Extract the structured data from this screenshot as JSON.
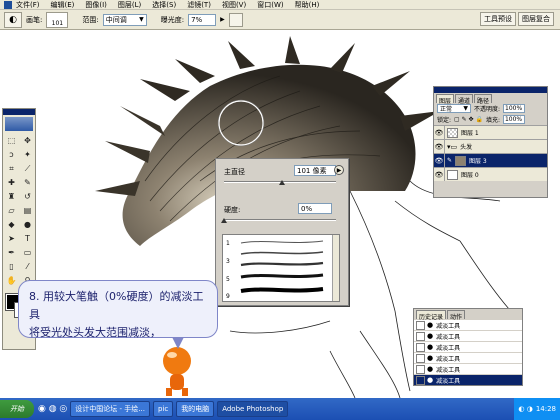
{
  "menubar": {
    "items": [
      "文件(F)",
      "编辑(E)",
      "图像(I)",
      "图层(L)",
      "选择(S)",
      "滤镜(T)",
      "视图(V)",
      "窗口(W)",
      "帮助(H)"
    ]
  },
  "options": {
    "brush_label": "画笔:",
    "brush_size": "101",
    "range_label": "范围:",
    "range_value": "中间调",
    "exposure_label": "曝光度:",
    "exposure_value": "7%",
    "well_tabs": [
      "工具预设",
      "图层复合"
    ]
  },
  "brush_panel": {
    "master_diameter_label": "主直径",
    "master_diameter_value": "101 像素",
    "hardness_label": "硬度:",
    "hardness_value": "0%",
    "master_diameter_fraction": 0.52,
    "hardness_fraction": 0.0,
    "preset_numbers": [
      "1",
      "3",
      "5",
      "9"
    ]
  },
  "layers_panel": {
    "tabs": [
      "图层",
      "通道",
      "路径"
    ],
    "blend_mode": "正常",
    "opacity_label": "不透明度:",
    "opacity_value": "100%",
    "lock_label": "锁定:",
    "fill_label": "填充:",
    "fill_value": "100%",
    "layers": [
      {
        "name": "图层 1",
        "type": "checker",
        "selected": false,
        "visible": true
      },
      {
        "name": "头发",
        "type": "folder",
        "selected": false,
        "visible": true
      },
      {
        "name": "图层 3",
        "type": "hair",
        "selected": true,
        "visible": true
      },
      {
        "name": "图层 0",
        "type": "white",
        "selected": false,
        "visible": true
      }
    ]
  },
  "history_panel": {
    "tabs": [
      "历史记录",
      "动作"
    ],
    "items": [
      {
        "label": "减淡工具",
        "selected": false
      },
      {
        "label": "减淡工具",
        "selected": false
      },
      {
        "label": "减淡工具",
        "selected": false
      },
      {
        "label": "减淡工具",
        "selected": false
      },
      {
        "label": "减淡工具",
        "selected": false
      },
      {
        "label": "减淡工具",
        "selected": true
      }
    ]
  },
  "callout": {
    "line1": "8. 用较大笔触（0%硬度）的减淡工具",
    "line2": "将受光处头发大范围减淡，"
  },
  "taskbar": {
    "start_label": "开始",
    "tasks": [
      "设计中国论坛 - 手绘...",
      "pic",
      "我的电脑",
      "Adobe Photoshop"
    ],
    "active_task": "Adobe Photoshop",
    "clock": "14:28"
  },
  "colors": {
    "title_blue": "#0a246a",
    "panel_gray": "#d4d0c8",
    "chrome": "#ece9d8",
    "callout_text": "#1a1f6b",
    "taskbar_blue": "#245edb"
  }
}
